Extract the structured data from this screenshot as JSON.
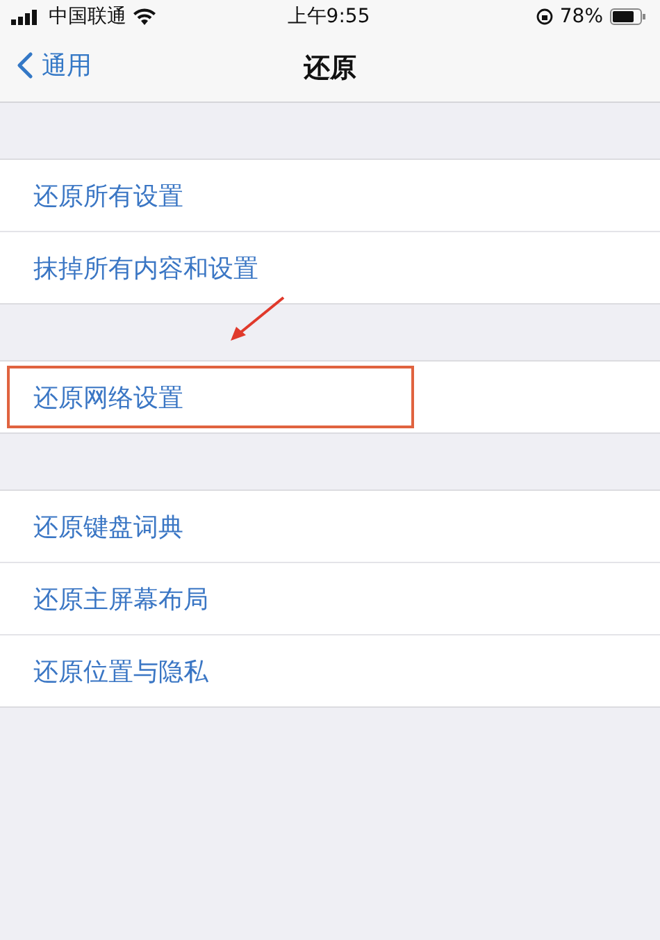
{
  "status_bar": {
    "carrier": "中国联通",
    "time": "上午9:55",
    "battery": "78%"
  },
  "nav": {
    "back": "通用",
    "title": "还原"
  },
  "groups": [
    {
      "pointer_arrow": false,
      "items": [
        {
          "label": "还原所有设置",
          "highlighted": false
        },
        {
          "label": "抹掉所有内容和设置",
          "highlighted": false
        }
      ]
    },
    {
      "pointer_arrow": true,
      "items": [
        {
          "label": "还原网络设置",
          "highlighted": true
        }
      ]
    },
    {
      "pointer_arrow": false,
      "items": [
        {
          "label": "还原键盘词典",
          "highlighted": false
        },
        {
          "label": "还原主屏幕布局",
          "highlighted": false
        },
        {
          "label": "还原位置与隐私",
          "highlighted": false
        }
      ]
    }
  ]
}
